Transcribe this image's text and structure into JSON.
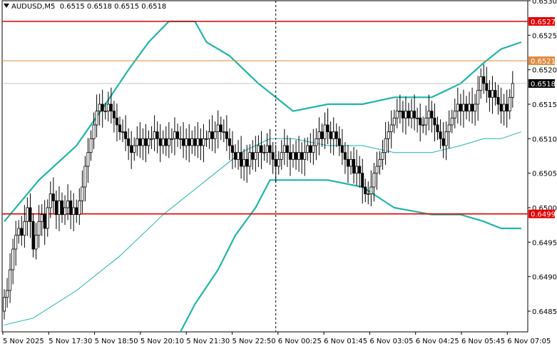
{
  "header": {
    "symbol": "AUDUSD,M5",
    "ohlc": "0.6515 0.6518 0.6515 0.6518"
  },
  "colors": {
    "candle": "#000000",
    "bollinger": "#1fb5a8",
    "support_resistance": "#e60000",
    "level_orange": "#e08a3c",
    "current_price_line": "#b0b0b0",
    "vertical_marker": "#000000"
  },
  "chart_data": {
    "type": "candlestick",
    "ylim": [
      0.6482,
      0.653
    ],
    "y_ticks": [
      "0.6530",
      "0.6525",
      "0.6520",
      "0.6515",
      "0.6510",
      "0.6505",
      "0.6500",
      "0.6495",
      "0.6490",
      "0.6485"
    ],
    "x_tick_labels": [
      "5 Nov 2025",
      "5 Nov 17:30",
      "5 Nov 18:50",
      "5 Nov 20:10",
      "5 Nov 21:30",
      "5 Nov 22:50",
      "6 Nov 00:25",
      "6 Nov 01:45",
      "6 Nov 03:05",
      "6 Nov 04:25",
      "6 Nov 05:45",
      "6 Nov 07:05"
    ],
    "horizontal_levels": [
      {
        "label": "0.6527",
        "value": 0.6527,
        "color": "red"
      },
      {
        "label": "0.6521",
        "value": 0.65213,
        "color": "orange"
      },
      {
        "label": "0.6518",
        "value": 0.6518,
        "color": "current"
      },
      {
        "label": "0.6499",
        "value": 0.64991,
        "color": "red"
      }
    ],
    "vertical_marker_index": 94,
    "closes": [
      0.6487,
      0.6488,
      0.6491,
      0.6494,
      0.6496,
      0.6497,
      0.6496,
      0.6498,
      0.65,
      0.6498,
      0.6494,
      0.6496,
      0.6498,
      0.6499,
      0.6497,
      0.65,
      0.6502,
      0.6501,
      0.6499,
      0.6501,
      0.6499,
      0.65,
      0.6501,
      0.6499,
      0.65,
      0.6499,
      0.6501,
      0.6503,
      0.6506,
      0.6508,
      0.651,
      0.6512,
      0.6514,
      0.6515,
      0.6514,
      0.6514,
      0.6515,
      0.6514,
      0.6513,
      0.6512,
      0.6511,
      0.6511,
      0.651,
      0.6509,
      0.6508,
      0.6509,
      0.651,
      0.6509,
      0.651,
      0.6509,
      0.651,
      0.651,
      0.6511,
      0.651,
      0.6509,
      0.651,
      0.6509,
      0.651,
      0.651,
      0.6511,
      0.651,
      0.651,
      0.6509,
      0.651,
      0.6509,
      0.651,
      0.6509,
      0.651,
      0.6509,
      0.651,
      0.651,
      0.6511,
      0.651,
      0.6511,
      0.6512,
      0.6511,
      0.6511,
      0.651,
      0.6509,
      0.6508,
      0.6507,
      0.6508,
      0.6506,
      0.6507,
      0.6506,
      0.6508,
      0.6507,
      0.6508,
      0.6509,
      0.6508,
      0.6508,
      0.6509,
      0.6508,
      0.6507,
      0.6506,
      0.6507,
      0.6508,
      0.6509,
      0.6508,
      0.6507,
      0.6508,
      0.6507,
      0.6508,
      0.6507,
      0.6508,
      0.6509,
      0.6508,
      0.6509,
      0.651,
      0.6511,
      0.651,
      0.6512,
      0.6511,
      0.651,
      0.6511,
      0.651,
      0.6509,
      0.6508,
      0.6507,
      0.6506,
      0.6507,
      0.6505,
      0.6506,
      0.6505,
      0.6503,
      0.6502,
      0.6502,
      0.6503,
      0.6505,
      0.6506,
      0.6507,
      0.6508,
      0.651,
      0.6511,
      0.6512,
      0.6513,
      0.6514,
      0.6514,
      0.6513,
      0.6514,
      0.6513,
      0.6514,
      0.6513,
      0.6513,
      0.6512,
      0.6512,
      0.6513,
      0.6514,
      0.6513,
      0.6512,
      0.6511,
      0.651,
      0.6509,
      0.6511,
      0.6512,
      0.6513,
      0.6514,
      0.6515,
      0.6514,
      0.6515,
      0.6514,
      0.6515,
      0.6514,
      0.6515,
      0.6517,
      0.6519,
      0.6518,
      0.6517,
      0.6516,
      0.6517,
      0.6516,
      0.6515,
      0.6514,
      0.6515,
      0.6514,
      0.6516,
      0.6518
    ],
    "bollinger": {
      "upper": [
        [
          0,
          0.6498
        ],
        [
          12,
          0.6504
        ],
        [
          25,
          0.6509
        ],
        [
          35,
          0.6515
        ],
        [
          43,
          0.652
        ],
        [
          50,
          0.6524
        ],
        [
          57,
          0.6527
        ],
        [
          66,
          0.6527
        ],
        [
          70,
          0.6524
        ],
        [
          78,
          0.6522
        ],
        [
          88,
          0.6518
        ],
        [
          100,
          0.6514
        ],
        [
          112,
          0.6515
        ],
        [
          124,
          0.6515
        ],
        [
          135,
          0.6516
        ],
        [
          148,
          0.6516
        ],
        [
          158,
          0.6518
        ],
        [
          166,
          0.6521
        ],
        [
          172,
          0.6523
        ],
        [
          179,
          0.6524
        ]
      ],
      "middle": [
        [
          0,
          0.6483
        ],
        [
          10,
          0.6484
        ],
        [
          25,
          0.6488
        ],
        [
          40,
          0.6493
        ],
        [
          55,
          0.6499
        ],
        [
          70,
          0.6504
        ],
        [
          82,
          0.6508
        ],
        [
          92,
          0.651
        ],
        [
          100,
          0.651
        ],
        [
          112,
          0.6509
        ],
        [
          124,
          0.6509
        ],
        [
          135,
          0.6508
        ],
        [
          148,
          0.6508
        ],
        [
          158,
          0.6509
        ],
        [
          166,
          0.651
        ],
        [
          172,
          0.651
        ],
        [
          179,
          0.6511
        ]
      ],
      "lower": [
        [
          61,
          0.6482
        ],
        [
          66,
          0.6486
        ],
        [
          74,
          0.6491
        ],
        [
          80,
          0.6496
        ],
        [
          87,
          0.65
        ],
        [
          92,
          0.6504
        ],
        [
          100,
          0.6504
        ],
        [
          112,
          0.6504
        ],
        [
          124,
          0.6503
        ],
        [
          135,
          0.65
        ],
        [
          148,
          0.6499
        ],
        [
          158,
          0.6499
        ],
        [
          166,
          0.6498
        ],
        [
          172,
          0.6497
        ],
        [
          179,
          0.6497
        ]
      ]
    }
  }
}
